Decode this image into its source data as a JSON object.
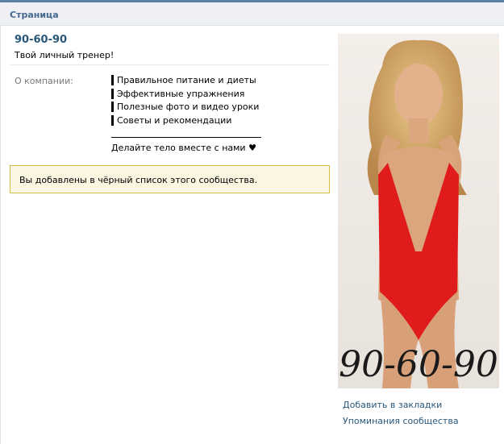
{
  "header": {
    "title": "Страница"
  },
  "group": {
    "name": "90-60-90",
    "status": "Твой личный тренер!"
  },
  "about": {
    "label": "О компании:",
    "items": [
      "Правильное питание и диеты",
      "Эффективные упражнения",
      "Полезные фото и видео уроки",
      "Советы и рекомендации"
    ],
    "footer": "Делайте тело вместе с нами ♥"
  },
  "notice": {
    "text": "Вы добавлены в чёрный список этого сообщества."
  },
  "avatar": {
    "caption": "90-60-90"
  },
  "sidebar": {
    "links": [
      "Добавить в закладки",
      "Упоминания сообщества"
    ]
  },
  "colors": {
    "accent": "#45688e",
    "link": "#2b587a",
    "notice_bg": "#fbf6e1",
    "notice_border": "#d4bc4c",
    "swimsuit": "#e01b1b"
  }
}
